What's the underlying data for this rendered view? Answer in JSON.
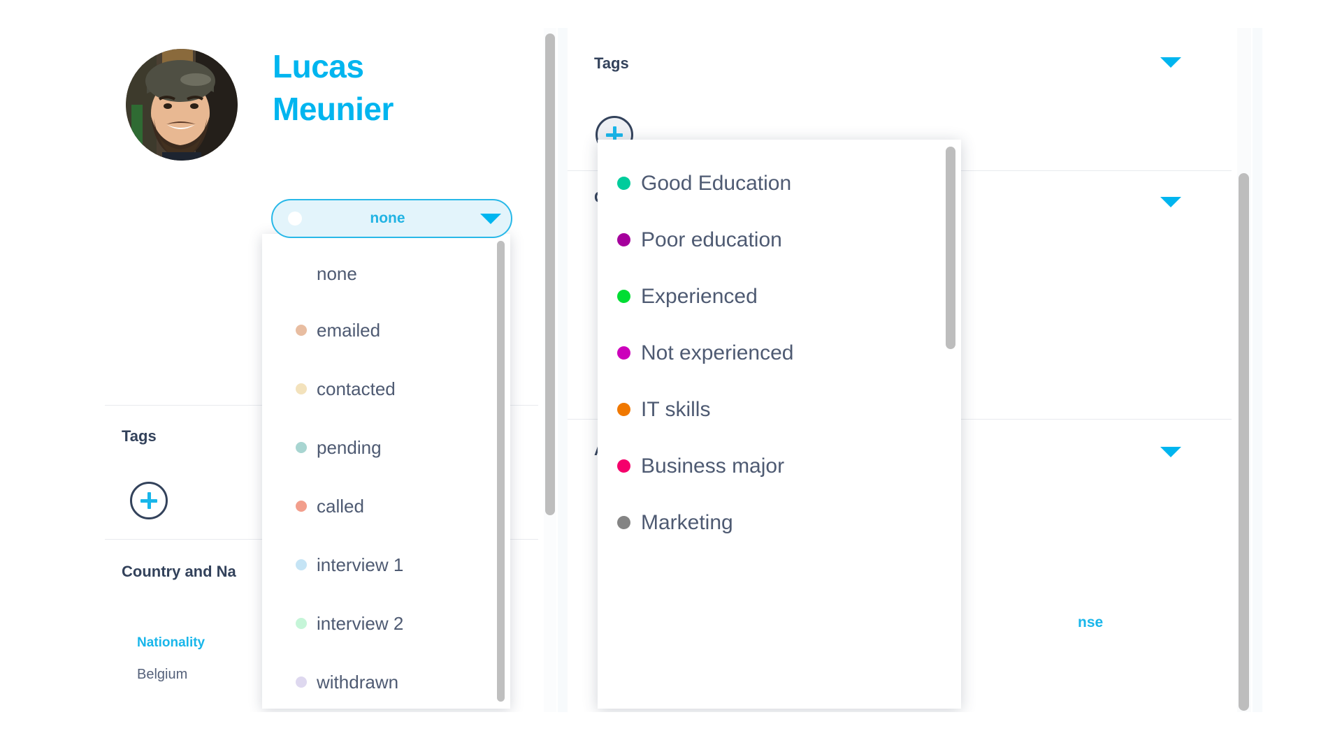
{
  "profile": {
    "name_line1": "Lucas",
    "name_line2": "Meunier",
    "avatar_icon": "user-photo-avatar"
  },
  "status_select": {
    "selected_label": "none",
    "selected_dot_color": "#ffffff",
    "caret_icon": "caret-down-icon",
    "options": [
      {
        "label": "none",
        "color": ""
      },
      {
        "label": "emailed",
        "color": "#e8bda1"
      },
      {
        "label": "contacted",
        "color": "#f3e2bc"
      },
      {
        "label": "pending",
        "color": "#a8d5d1"
      },
      {
        "label": "called",
        "color": "#f29e8c"
      },
      {
        "label": "interview 1",
        "color": "#c5e4f5"
      },
      {
        "label": "interview 2",
        "color": "#c5f5d8"
      },
      {
        "label": "withdrawn",
        "color": "#ded8ef"
      }
    ]
  },
  "left_panel": {
    "tags_section": {
      "title": "Tags",
      "add_button_icon": "plus-icon"
    },
    "country_section": {
      "title": "Country and Na",
      "nationality_label": "Nationality",
      "nationality_value": "Belgium"
    }
  },
  "right_panel": {
    "tags_section": {
      "title": "Tags",
      "add_button_icon": "plus-icon",
      "caret_icon": "caret-down-icon"
    },
    "country_section": {
      "title": "C",
      "caret_icon": "caret-down-icon"
    },
    "availability_section": {
      "title": "A",
      "caret_icon": "caret-down-icon",
      "link_text": "nse"
    }
  },
  "tag_menu": {
    "items": [
      {
        "label": "Good Education",
        "color": "#00cc9c"
      },
      {
        "label": "Poor education",
        "color": "#a5009c"
      },
      {
        "label": "Experienced",
        "color": "#00dd33"
      },
      {
        "label": "Not experienced",
        "color": "#cc00bb"
      },
      {
        "label": "IT skills",
        "color": "#f07800"
      },
      {
        "label": "Business major",
        "color": "#f5006b"
      },
      {
        "label": "Marketing",
        "color": "#848484"
      }
    ]
  },
  "colors": {
    "brand_blue": "#00b5ef",
    "dark_navy": "#33425b",
    "body_text": "#4e5a72",
    "pill_bg": "#e3f4fb",
    "scrollbar": "#bdbdbd"
  }
}
